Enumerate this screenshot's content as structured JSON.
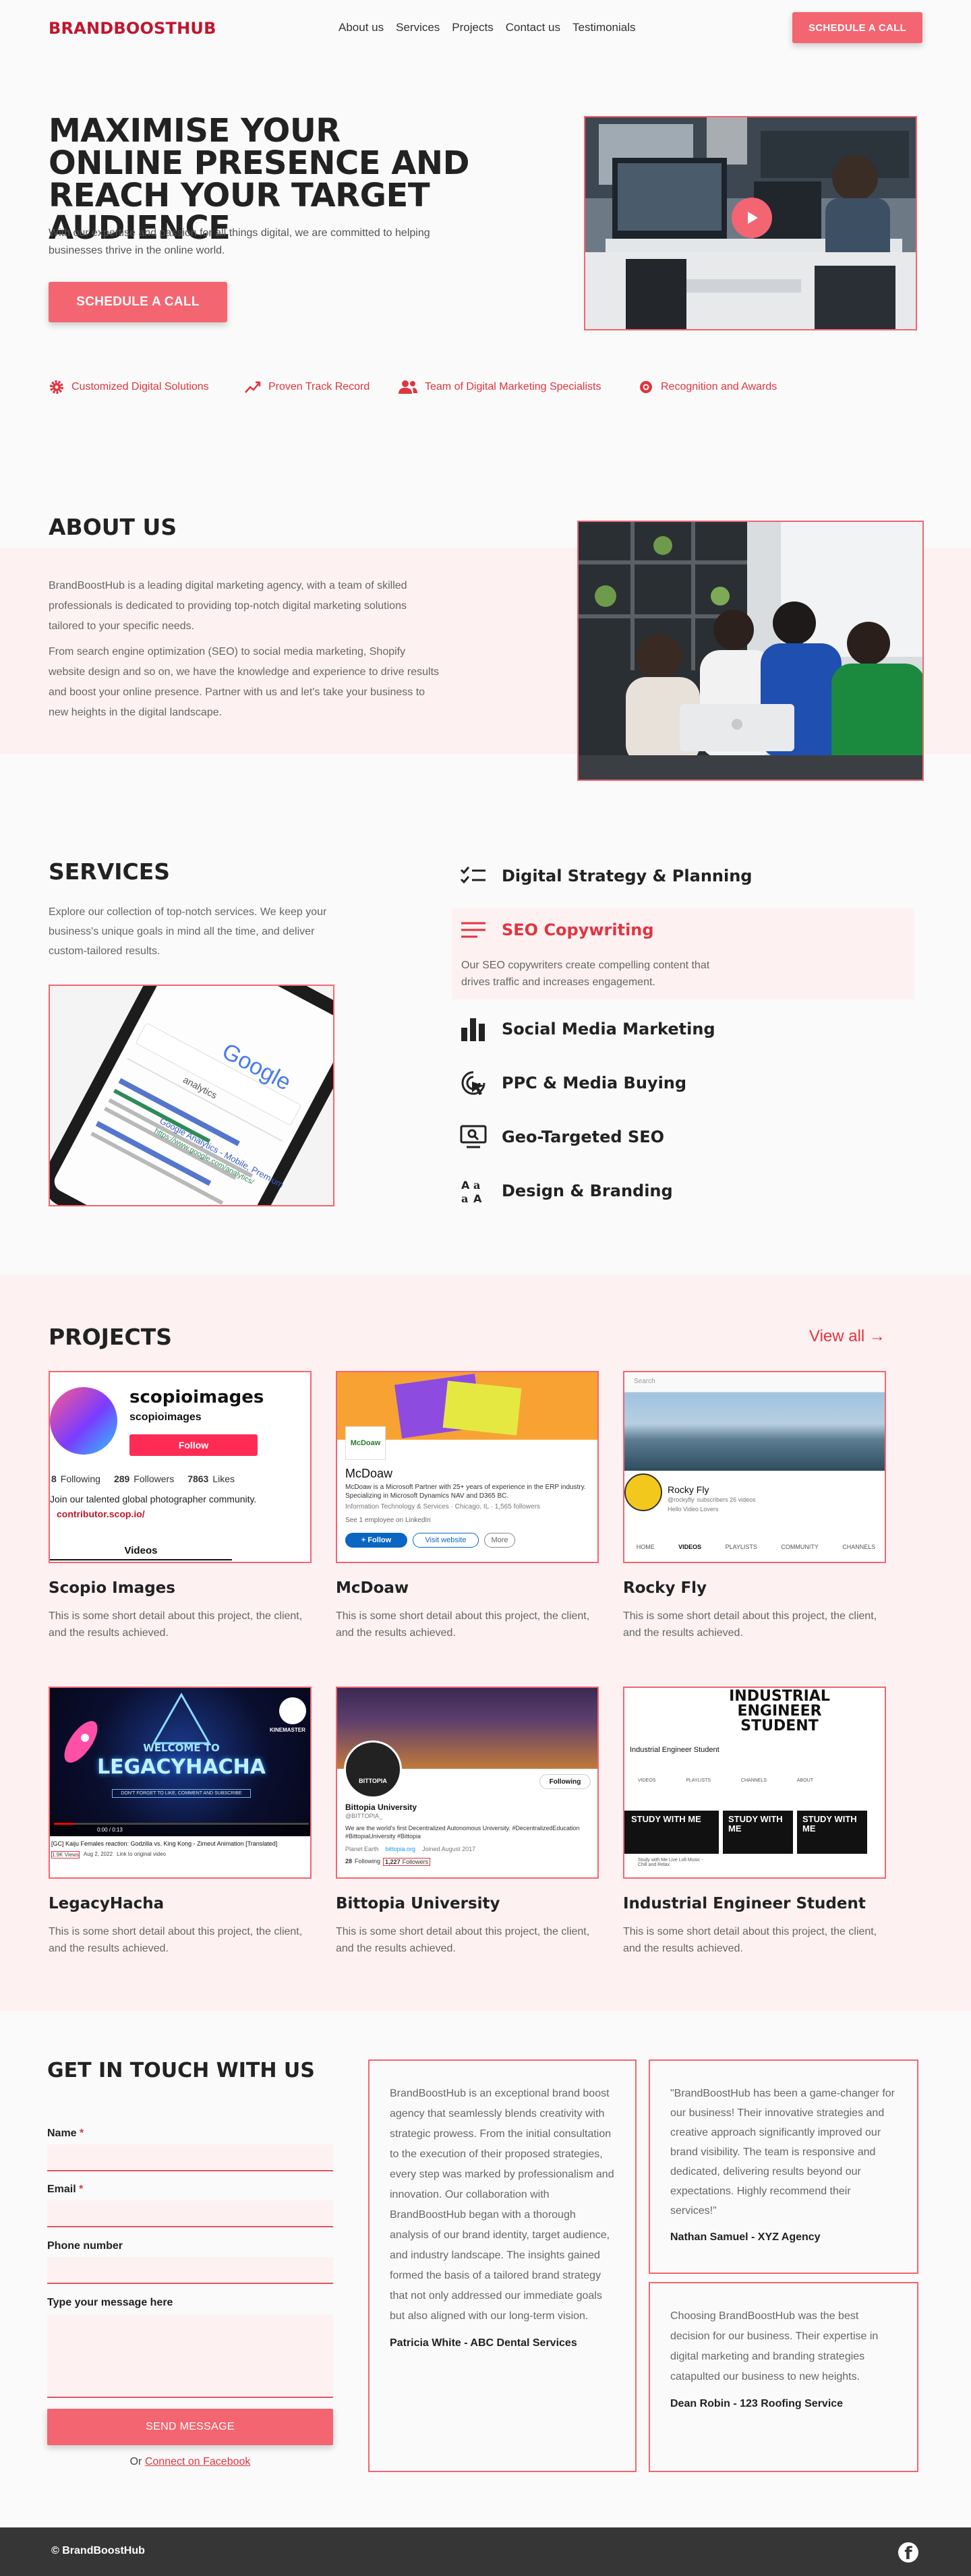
{
  "nav": {
    "logo": "BRANDBOOSTHUB",
    "links": [
      "About us",
      "Services",
      "Projects",
      "Contact us",
      "Testimonials"
    ],
    "cta": "SCHEDULE A CALL"
  },
  "hero": {
    "title": "MAXIMISE YOUR ONLINE PRESENCE AND REACH YOUR TARGET AUDIENCE",
    "subtitle": "With our expertise and passion for all things digital, we are committed to helping businesses thrive in the online world.",
    "cta": "SCHEDULE A CALL",
    "features": [
      {
        "label": "Customized Digital Solutions",
        "icon": "gear-icon"
      },
      {
        "label": "Proven Track Record",
        "icon": "trend-icon"
      },
      {
        "label": "Team of Digital Marketing Specialists",
        "icon": "team-icon"
      },
      {
        "label": "Recognition and Awards",
        "icon": "award-icon"
      }
    ]
  },
  "about": {
    "title": "ABOUT US",
    "p1": "BrandBoostHub is a leading digital marketing agency, with a team of skilled professionals is dedicated to providing top-notch digital marketing solutions tailored to your specific needs.",
    "p2": "From search engine optimization (SEO) to social media marketing, Shopify website design and so on, we have the knowledge and experience to drive results and boost your online presence. Partner with us and let's take your business to new heights in the digital landscape."
  },
  "services": {
    "title": "SERVICES",
    "intro": "Explore our collection of top-notch services. We keep your business's unique goals in mind all the time, and deliver custom-tailored results.",
    "items": [
      {
        "label": "Digital Strategy & Planning",
        "icon": "checklist-icon"
      },
      {
        "label": "SEO Copywriting",
        "icon": "lines-icon",
        "active": true,
        "desc": "Our SEO copywriters create compelling content that drives traffic and increases engagement."
      },
      {
        "label": "Social Media Marketing",
        "icon": "bar-chart-icon"
      },
      {
        "label": "PPC & Media Buying",
        "icon": "cursor-click-icon"
      },
      {
        "label": "Geo-Targeted SEO",
        "icon": "monitor-search-icon"
      },
      {
        "label": "Design & Branding",
        "icon": "typography-icon"
      }
    ],
    "thumb": {
      "google": "Google",
      "search": "analytics",
      "result1": "Google Analytics - Mobile, Premium",
      "result2": "https://www.google.com/analytics/"
    }
  },
  "projects": {
    "title": "PROJECTS",
    "view_all": "View all →",
    "desc": "This is some short detail about this project, the client, and the results achieved.",
    "items": [
      {
        "title": "Scopio Images"
      },
      {
        "title": "McDoaw"
      },
      {
        "title": "Rocky Fly"
      },
      {
        "title": "LegacyHacha"
      },
      {
        "title": "Bittopia University"
      },
      {
        "title": "Industrial Engineer Student"
      }
    ],
    "scopio": {
      "name": "scopioimages",
      "handle": "scopioimages",
      "follow": "Follow",
      "following": "8",
      "following_label": "Following",
      "followers": "289",
      "followers_label": "Followers",
      "likes": "7863",
      "likes_label": "Likes",
      "bio": "Join our talented global photographer community.",
      "link": "contributor.scop.io/",
      "tab": "Videos"
    },
    "mcdoaw": {
      "name": "McDoaw",
      "logo": "McDoaw",
      "desc": "McDoaw is a Microsoft Partner with 25+ years of experience in the ERP industry. Specializing in Microsoft Dynamics NAV and D365 BC.",
      "meta": "Information Technology & Services · Chicago, IL · 1,565 followers",
      "employees": "See 1 employee on LinkedIn",
      "follow": "+ Follow",
      "visit": "Visit website",
      "more": "More"
    },
    "rocky": {
      "search": "Search",
      "name": "Rocky Fly",
      "handle": "@rockyfly",
      "subs": "subscribers 26 videos",
      "sub2": "Hello Video Lovers",
      "tabs": [
        "HOME",
        "VIDEOS",
        "PLAYLISTS",
        "COMMUNITY",
        "CHANNELS"
      ]
    },
    "legacy": {
      "welcome": "WELCOME TO",
      "name": "LEGACYHACHA",
      "tagline": "DON'T FORGET TO LIKE, COMMENT AND SUBSCRIBE",
      "brand": "KINEMASTER",
      "time": "0:00 / 0:13",
      "caption": "[GC] Kaiju Females reaction: Godzilla vs. King Kong - Zimeut Animation [Translated]",
      "views": "1.9K Views",
      "date": "Aug 2, 2022",
      "link": "Link to original video"
    },
    "bittopia": {
      "logo": "BITTOPIA",
      "name": "Bittopia University",
      "handle": "@BITTOPIA_",
      "bio": "We are the world's first Decentralized Autonomous University. #DecentralizedEducation #BittopiaUniversity #Bittopia",
      "location": "Planet Earth",
      "site": "bittopia.org",
      "joined": "Joined August 2017",
      "following": "28",
      "following_label": "Following",
      "followers": "1,227",
      "followers_label": "Followers",
      "follow_btn": "Following"
    },
    "ies": {
      "banner": "INDUSTRIAL ENGINEER STUDENT",
      "name": "Industrial Engineer Student",
      "tabs": [
        "VIDEOS",
        "PLAYLISTS",
        "CHANNELS",
        "ABOUT"
      ],
      "thumb": "STUDY WITH ME",
      "caption": "Study with Me Live Lofi Music - Chill and Relax"
    }
  },
  "contact": {
    "title": "GET IN TOUCH WITH US",
    "fields": [
      {
        "label": "Name",
        "required": true
      },
      {
        "label": "Email",
        "required": true
      },
      {
        "label": "Phone number",
        "required": false
      },
      {
        "label": "Type your message here",
        "required": false
      }
    ],
    "required_mark": "*",
    "submit": "SEND MESSAGE",
    "or_text": "Or",
    "facebook": "Connect on Facebook"
  },
  "testimonials": [
    {
      "text": "BrandBoostHub is an exceptional brand boost agency that seamlessly blends creativity with strategic prowess. From the initial consultation to the execution of their proposed strategies, every step was marked by professionalism and innovation. Our collaboration with BrandBoostHub began with a thorough analysis of our brand identity, target audience, and industry landscape. The insights gained formed the basis of a tailored brand strategy that not only addressed our immediate goals but also aligned with our long-term vision.",
      "author": "Patricia White - ABC Dental Services"
    },
    {
      "text": "\"BrandBoostHub has been a game-changer for our business! Their innovative strategies and creative approach significantly improved our brand visibility. The team is responsive and dedicated, delivering results beyond our expectations. Highly recommend their services!\"",
      "author": "Nathan Samuel - XYZ Agency"
    },
    {
      "text": "Choosing BrandBoostHub was the best decision for our business. Their expertise in digital marketing and branding strategies catapulted our business to new heights.",
      "author": "Dean Robin - 123 Roofing Service"
    }
  ],
  "footer": {
    "copyright": "© BrandBoostHub",
    "social": "facebook-icon"
  },
  "colors": {
    "accent": "#f36570",
    "brand": "#c0162e",
    "tint": "#fdf1f2",
    "footer": "#363636"
  }
}
